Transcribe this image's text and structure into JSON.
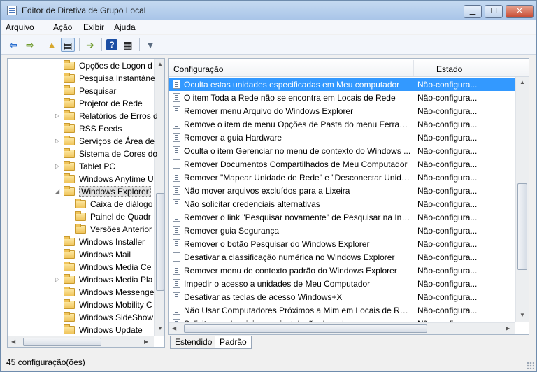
{
  "window": {
    "title": "Editor de Diretiva de Grupo Local"
  },
  "window_controls": {
    "minimize": "▁",
    "maximize": "☐",
    "close": "✕"
  },
  "menu": {
    "items": [
      "Arquivo",
      "Ação",
      "Exibir",
      "Ajuda"
    ]
  },
  "toolbar": {
    "icons": [
      "back-arrow-icon",
      "forward-arrow-icon",
      "up-folder-icon",
      "show-hide-tree-icon",
      "export-list-icon",
      "help-icon",
      "properties-icon",
      "filter-icon"
    ]
  },
  "tree": {
    "items": [
      {
        "label": "Opções de Logon d",
        "expandable": false
      },
      {
        "label": "Pesquisa Instantâne",
        "expandable": false
      },
      {
        "label": "Pesquisar",
        "expandable": false
      },
      {
        "label": "Projetor de Rede",
        "expandable": false
      },
      {
        "label": "Relatórios de Erros d",
        "expandable": true
      },
      {
        "label": "RSS Feeds",
        "expandable": false
      },
      {
        "label": "Serviços de Área de",
        "expandable": true
      },
      {
        "label": "Sistema de Cores do",
        "expandable": false
      },
      {
        "label": "Tablet PC",
        "expandable": true
      },
      {
        "label": "Windows Anytime U",
        "expandable": false
      },
      {
        "label": "Windows Explorer",
        "expandable": true,
        "expanded": true,
        "selected": true
      },
      {
        "label": "Caixa de diálogo",
        "expandable": false,
        "child": true
      },
      {
        "label": "Painel de Quadr",
        "expandable": false,
        "child": true
      },
      {
        "label": "Versões Anterior",
        "expandable": false,
        "child": true
      },
      {
        "label": "Windows Installer",
        "expandable": false
      },
      {
        "label": "Windows Mail",
        "expandable": false
      },
      {
        "label": "Windows Media Ce",
        "expandable": false
      },
      {
        "label": "Windows Media Pla",
        "expandable": true
      },
      {
        "label": "Windows Messenge",
        "expandable": false
      },
      {
        "label": "Windows Mobility C",
        "expandable": false
      },
      {
        "label": "Windows SideShow",
        "expandable": false
      },
      {
        "label": "Windows Update",
        "expandable": false
      }
    ]
  },
  "list": {
    "columns": {
      "config": "Configuração",
      "state": "Estado"
    },
    "rows": [
      {
        "name": "Oculta estas unidades especificadas em Meu computador",
        "state": "Não-configura...",
        "selected": true
      },
      {
        "name": "O item Toda a Rede não se encontra em Locais de Rede",
        "state": "Não-configura..."
      },
      {
        "name": "Remover menu Arquivo do Windows Explorer",
        "state": "Não-configura..."
      },
      {
        "name": "Remove o item de menu Opções de Pasta do menu Ferrame...",
        "state": "Não-configura..."
      },
      {
        "name": "Remover a guia Hardware",
        "state": "Não-configura..."
      },
      {
        "name": "Oculta o item Gerenciar no menu de contexto do Windows ...",
        "state": "Não-configura..."
      },
      {
        "name": "Remover Documentos Compartilhados de Meu Computador",
        "state": "Não-configura..."
      },
      {
        "name": "Remover \"Mapear Unidade de Rede\" e \"Desconectar Unidad...",
        "state": "Não-configura..."
      },
      {
        "name": "Não mover arquivos excluídos para a Lixeira",
        "state": "Não-configura..."
      },
      {
        "name": "Não solicitar credenciais alternativas",
        "state": "Não-configura..."
      },
      {
        "name": "Remover o link \"Pesquisar novamente\" de Pesquisar na Inter...",
        "state": "Não-configura..."
      },
      {
        "name": "Remover guia Segurança",
        "state": "Não-configura..."
      },
      {
        "name": "Remover o botão Pesquisar do Windows Explorer",
        "state": "Não-configura..."
      },
      {
        "name": "Desativar a classificação numérica no Windows Explorer",
        "state": "Não-configura..."
      },
      {
        "name": "Remover menu de contexto padrão do Windows Explorer",
        "state": "Não-configura..."
      },
      {
        "name": "Impedir o acesso a unidades de Meu Computador",
        "state": "Não-configura..."
      },
      {
        "name": "Desativar as teclas de acesso Windows+X",
        "state": "Não-configura..."
      },
      {
        "name": "Não Usar Computadores Próximos a Mim em Locais de Rede",
        "state": "Não-configura..."
      },
      {
        "name": "Solicitar credenciais para instalação de rede",
        "state": "Não-configura..."
      }
    ]
  },
  "tabs": [
    {
      "label": "Estendido"
    },
    {
      "label": "Padrão",
      "active": true
    }
  ],
  "status": {
    "text": "45 configuração(ões)"
  }
}
